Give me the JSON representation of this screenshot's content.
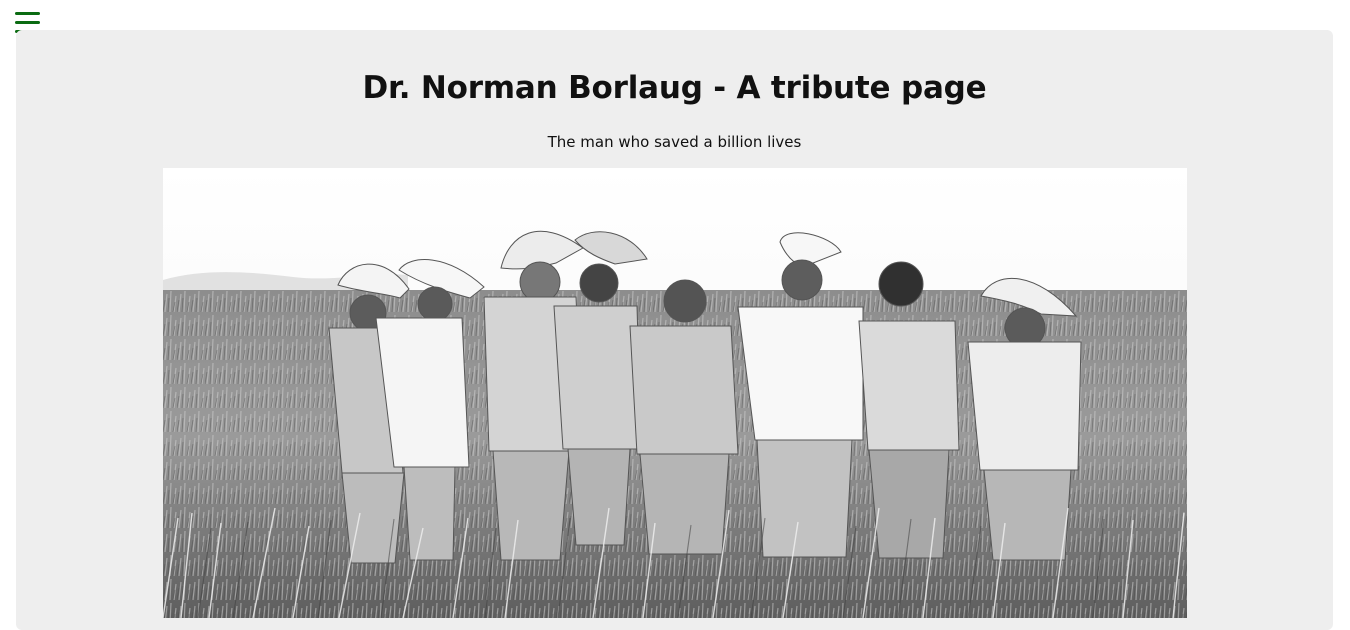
{
  "header": {
    "menu_icon": "hamburger-menu-icon",
    "menu_color": "#0b6b12"
  },
  "main": {
    "title": "Dr. Norman Borlaug - A tribute page",
    "subtitle": "The man who saved a billion lives",
    "image": {
      "subject": "black-and-white photograph of men in hats standing in a wheat field",
      "style": "grayscale"
    },
    "background": "#eeeeee"
  }
}
